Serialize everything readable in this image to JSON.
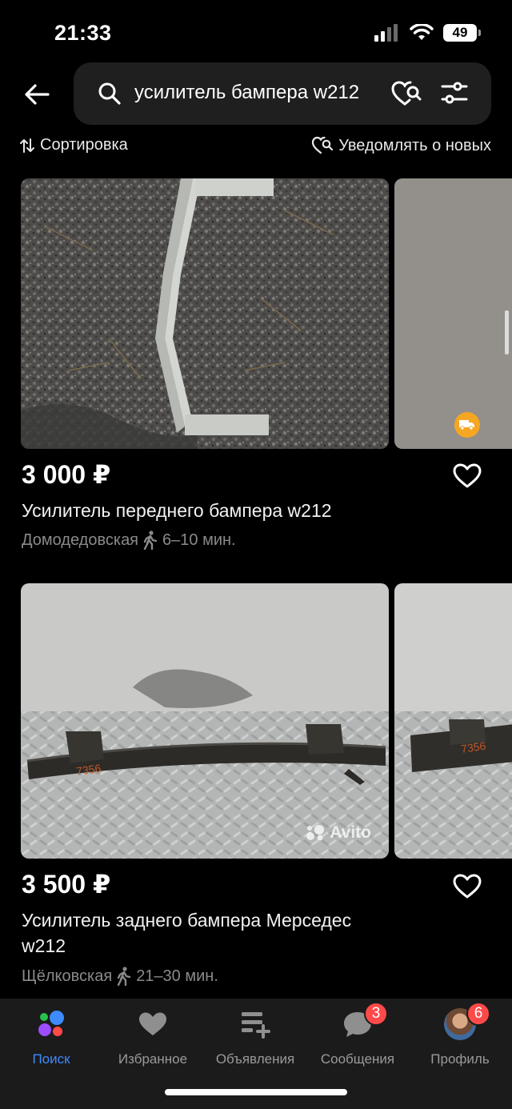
{
  "status_bar": {
    "time": "21:33",
    "battery": "49"
  },
  "search": {
    "query": "усилитель бампера w212"
  },
  "toolbar": {
    "sort_label": "Сортировка",
    "notify_label": "Уведомлять о новых"
  },
  "listings": [
    {
      "price": "3 000 ₽",
      "title": "Усилитель переднего бампера w212",
      "station": "Домодедовская",
      "walk_time": "6–10 мин.",
      "delivery": true
    },
    {
      "price": "3 500 ₽",
      "title": "Усилитель заднего бампера Мерседес w212",
      "station": "Щёлковская",
      "walk_time": "21–30 мин.",
      "watermark": "Avito"
    }
  ],
  "tab_bar": {
    "tabs": [
      {
        "label": "Поиск",
        "icon": "avito-logo-icon",
        "active": true
      },
      {
        "label": "Избранное",
        "icon": "heart-icon"
      },
      {
        "label": "Объявления",
        "icon": "ads-list-icon"
      },
      {
        "label": "Сообщения",
        "icon": "chat-bubble-icon",
        "badge": "3"
      },
      {
        "label": "Профиль",
        "icon": "avatar",
        "badge": "6"
      }
    ]
  },
  "colors": {
    "accent": "#3d8bff",
    "badge": "#ff4a4a",
    "delivery": "#f5a623",
    "background": "#000000",
    "surface": "#1f1f1f"
  }
}
